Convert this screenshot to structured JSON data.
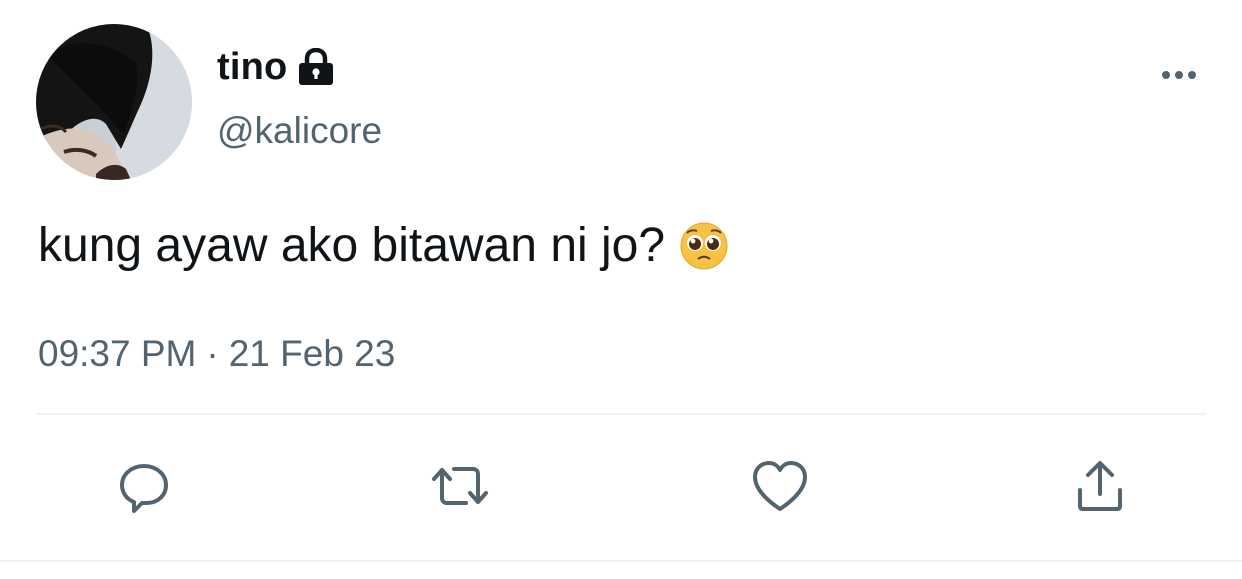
{
  "tweet": {
    "author": {
      "display_name": "tino",
      "handle": "@kalicore",
      "protected_icon": "lock-icon"
    },
    "text": "kung ayaw ako bitawan ni jo?",
    "emoji": "pleading-face-emoji",
    "time": "09:37 PM",
    "separator": "·",
    "date": "21 Feb 23"
  },
  "actions": [
    {
      "name": "reply",
      "icon": "reply-icon"
    },
    {
      "name": "retweet",
      "icon": "retweet-icon"
    },
    {
      "name": "like",
      "icon": "heart-icon"
    },
    {
      "name": "share",
      "icon": "share-icon"
    }
  ],
  "colors": {
    "text": "#0f1419",
    "secondary": "#536471",
    "divider": "#eff3f4"
  }
}
